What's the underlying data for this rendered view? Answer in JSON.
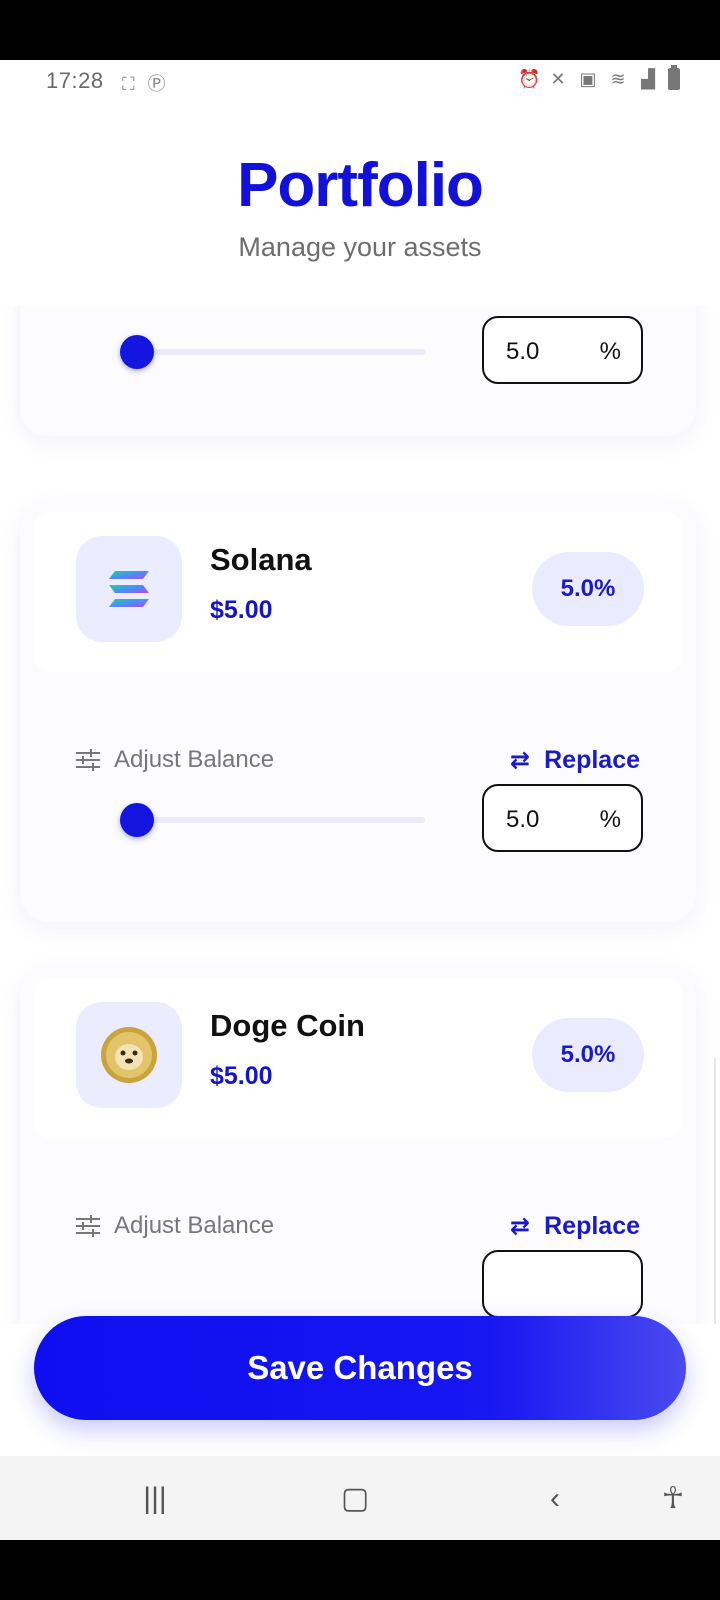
{
  "status_bar": {
    "time": "17:28",
    "left_icons": [
      "screenshot-icon",
      "screenshot-icon",
      "notification-icon"
    ],
    "right_icons": [
      "alarm-icon",
      "mute-icon",
      "lock-icon",
      "wifi-icon",
      "signal-icon",
      "battery-icon"
    ]
  },
  "header": {
    "title": "Portfolio",
    "subtitle": "Manage your assets"
  },
  "top_slider": {
    "percent": 5.0,
    "value_text": "5.0",
    "unit": "%"
  },
  "assets": [
    {
      "name": "Solana",
      "value": "$5.00",
      "allocation": "5.0%",
      "icon": "solana-icon",
      "adjust_label": "Adjust Balance",
      "replace_label": "Replace",
      "slider_percent": 5.0,
      "input_value": "5.0",
      "input_unit": "%"
    },
    {
      "name": "Doge Coin",
      "value": "$5.00",
      "allocation": "5.0%",
      "icon": "dogecoin-icon",
      "adjust_label": "Adjust Balance",
      "replace_label": "Replace"
    }
  ],
  "actions": {
    "save_label": "Save Changes"
  },
  "colors": {
    "accent": "#1111d9",
    "pill_bg": "#ebebff",
    "track": "#eaeaf8"
  },
  "nav": [
    "recents-icon",
    "home-icon",
    "back-icon",
    "accessibility-icon"
  ]
}
